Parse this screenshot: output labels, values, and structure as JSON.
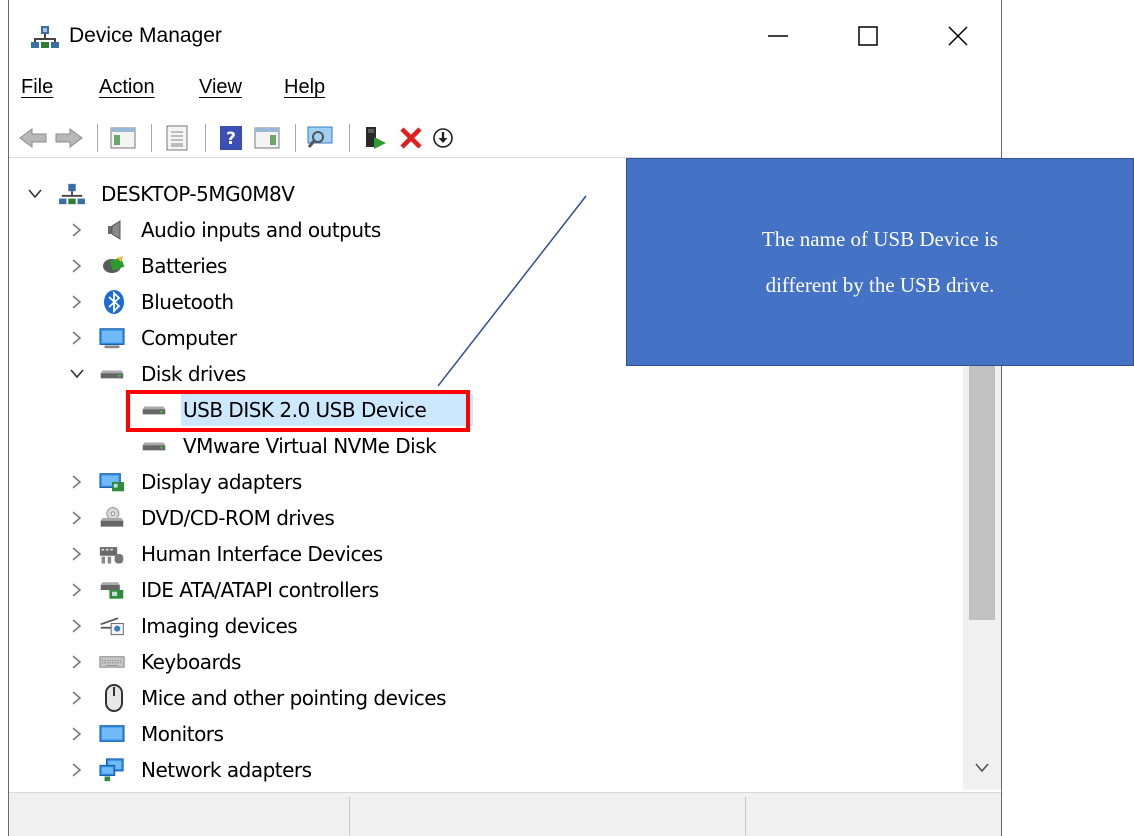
{
  "window": {
    "title": "Device Manager"
  },
  "menu": {
    "items": [
      "File",
      "Action",
      "View",
      "Help"
    ]
  },
  "toolbar": {
    "buttons": [
      "back-arrow-icon",
      "forward-arrow-icon",
      "show-hide-console-tree-icon",
      "properties-icon",
      "help-icon",
      "show-action-pane-icon",
      "scan-hardware-changes-icon",
      "update-driver-icon",
      "uninstall-device-icon",
      "disable-device-icon"
    ]
  },
  "tree": {
    "root": "DESKTOP-5MG0M8V",
    "categories": [
      {
        "label": "Audio inputs and outputs",
        "icon": "speaker-icon",
        "expanded": false
      },
      {
        "label": "Batteries",
        "icon": "battery-icon",
        "expanded": false
      },
      {
        "label": "Bluetooth",
        "icon": "bluetooth-icon",
        "expanded": false
      },
      {
        "label": "Computer",
        "icon": "monitor-icon",
        "expanded": false
      },
      {
        "label": "Disk drives",
        "icon": "disk-drive-icon",
        "expanded": true,
        "children": [
          {
            "label": "USB DISK 2.0 USB Device",
            "selected": true
          },
          {
            "label": "VMware Virtual NVMe Disk",
            "selected": false
          }
        ]
      },
      {
        "label": "Display adapters",
        "icon": "display-adapter-icon",
        "expanded": false
      },
      {
        "label": "DVD/CD-ROM drives",
        "icon": "dvd-drive-icon",
        "expanded": false
      },
      {
        "label": "Human Interface Devices",
        "icon": "hid-icon",
        "expanded": false
      },
      {
        "label": "IDE ATA/ATAPI controllers",
        "icon": "ide-controller-icon",
        "expanded": false
      },
      {
        "label": "Imaging devices",
        "icon": "camera-icon",
        "expanded": false
      },
      {
        "label": "Keyboards",
        "icon": "keyboard-icon",
        "expanded": false
      },
      {
        "label": "Mice and other pointing devices",
        "icon": "mouse-icon",
        "expanded": false
      },
      {
        "label": "Monitors",
        "icon": "monitor-icon",
        "expanded": false
      },
      {
        "label": "Network adapters",
        "icon": "network-adapter-icon",
        "expanded": false
      }
    ]
  },
  "callout": {
    "lines": [
      "The name of USB Device is",
      "different by the USB drive."
    ],
    "fill_color": "#4472c4",
    "highlight_color": "#ff0000"
  },
  "colors": {
    "selection": "#cce8ff"
  }
}
